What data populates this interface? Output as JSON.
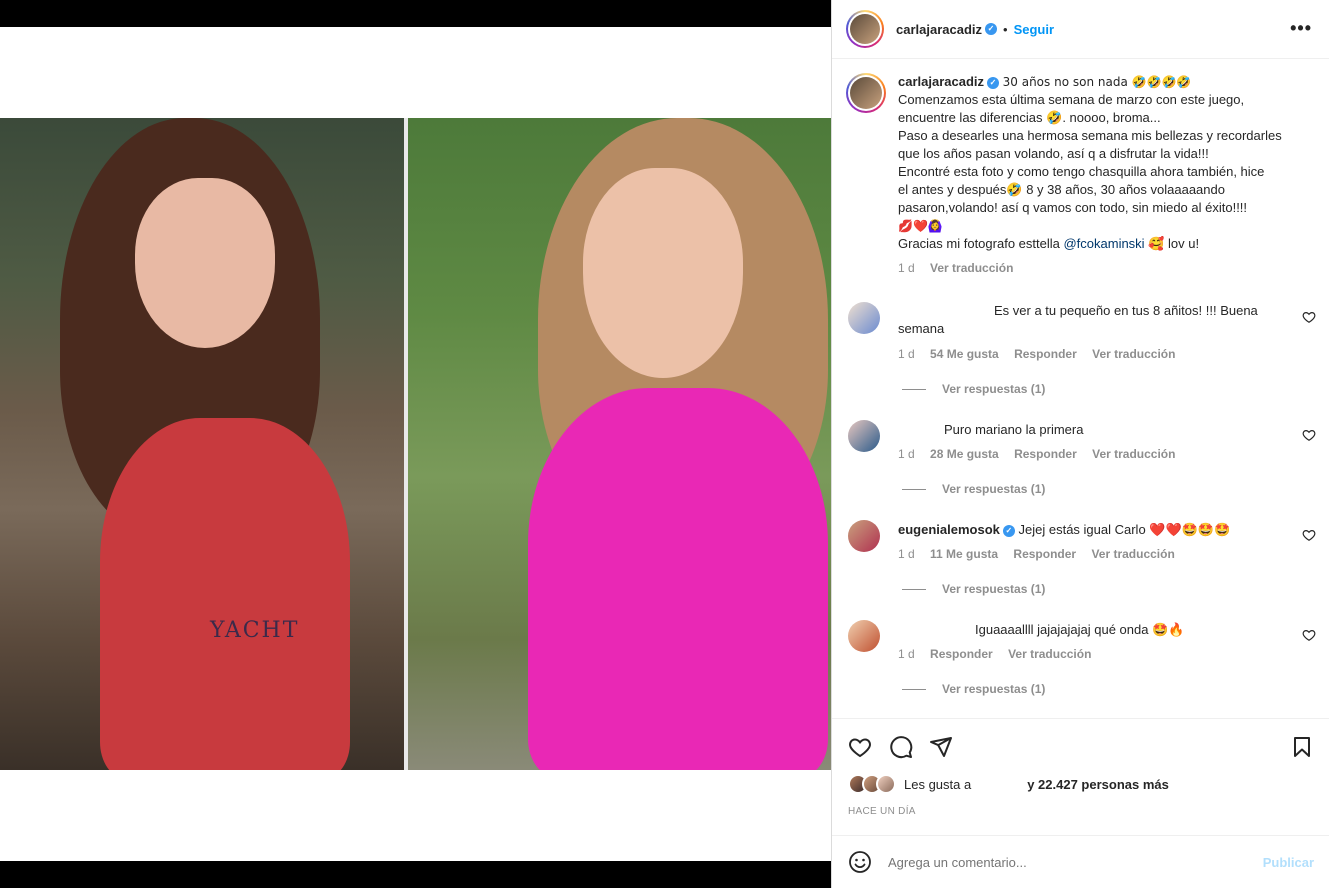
{
  "post": {
    "username": "carlajaracadiz",
    "follow_label": "Seguir",
    "more_label": "•••",
    "image": {
      "left_print": "YACHT"
    }
  },
  "caption": {
    "username": "carlajaracadiz",
    "lines": [
      "30 años no son nada 🤣🤣🤣🤣",
      "Comenzamos esta última semana de marzo con este juego,",
      "encuentre las diferencias 🤣. noooo, broma...",
      "Paso a desearles una hermosa semana mis bellezas y recordarles",
      "que los años pasan volando, así q a disfrutar la vida!!!",
      "Encontré esta foto y como tengo chasquilla ahora también, hice",
      "el antes y después🤣 8 y 38 años, 30 años volaaaaando",
      "pasaron,volando! así q vamos con todo, sin miedo al éxito!!!!",
      "💋❤️🙆‍♀️"
    ],
    "thanks_prefix": "Gracias mi fotografo esttella ",
    "mention": "@fcokaminski",
    "thanks_suffix": " 🥰 lov u!",
    "time": "1 d",
    "translate": "Ver traducción"
  },
  "comments": [
    {
      "text_line1": "Es ver a tu pequeño en tus 8 añitos! !!! Buena",
      "text_line2": "semana",
      "time": "1 d",
      "likes": "54 Me gusta",
      "reply": "Responder",
      "translate": "Ver traducción",
      "replies": "Ver respuestas (1)"
    },
    {
      "text": "Puro mariano la primera",
      "time": "1 d",
      "likes": "28 Me gusta",
      "reply": "Responder",
      "translate": "Ver traducción",
      "replies": "Ver respuestas (1)"
    },
    {
      "username": "eugenialemosok",
      "text": "Jejej estás igual Carlo ❤️❤️🤩🤩🤩",
      "time": "1 d",
      "likes": "11 Me gusta",
      "reply": "Responder",
      "translate": "Ver traducción",
      "replies": "Ver respuestas (1)"
    },
    {
      "text": "Iguaaaallll jajajajajaj qué onda 🤩🔥",
      "time": "1 d",
      "reply": "Responder",
      "translate": "Ver traducción",
      "replies": "Ver respuestas (1)"
    }
  ],
  "likes": {
    "prefix": "Les gusta a",
    "count": "y 22.427 personas más"
  },
  "time_ago": "HACE UN DÍA",
  "add_comment": {
    "placeholder": "Agrega un comentario...",
    "post_label": "Publicar"
  },
  "colors": {
    "accent": "#0095f6",
    "verified": "#3897f0",
    "muted": "#8e8e8e"
  }
}
